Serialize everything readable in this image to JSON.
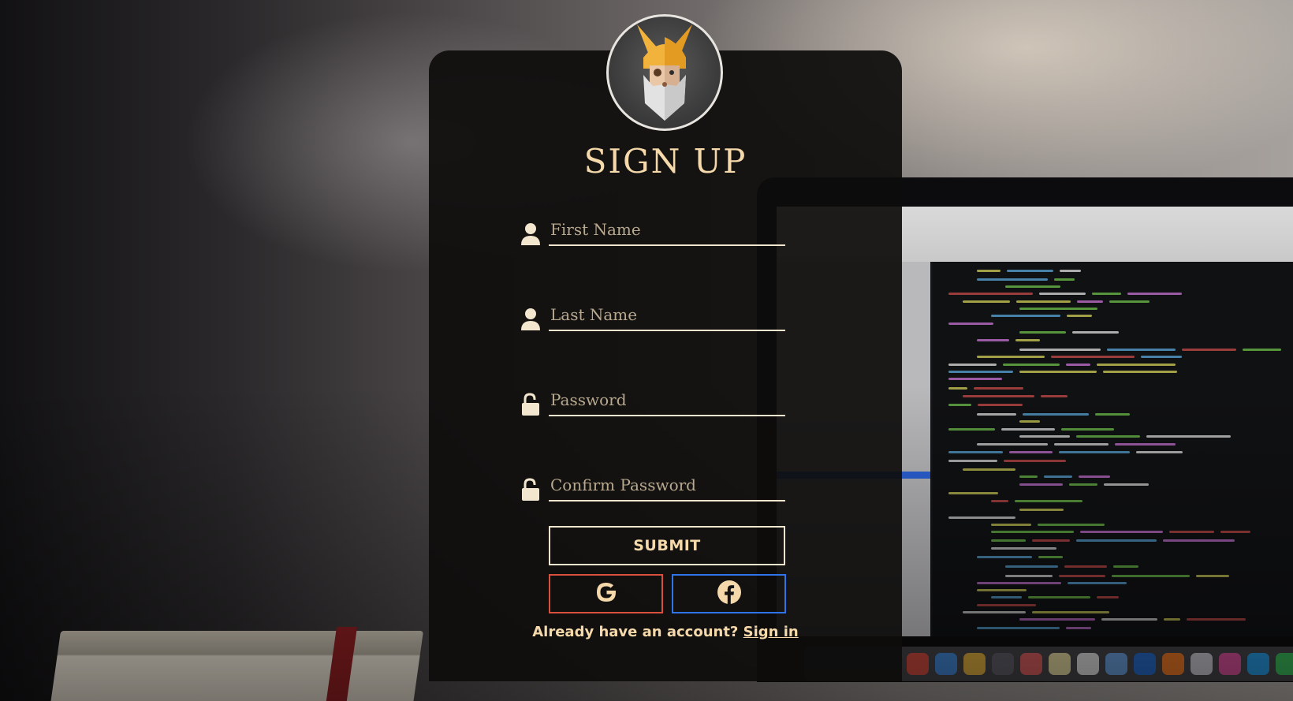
{
  "form": {
    "title": "SIGN UP",
    "fields": [
      {
        "name": "first-name",
        "placeholder": "First Name",
        "value": "",
        "icon": "user-icon"
      },
      {
        "name": "last-name",
        "placeholder": "Last Name",
        "value": "",
        "icon": "user-icon"
      },
      {
        "name": "password",
        "placeholder": "Password",
        "value": "",
        "icon": "unlock-icon"
      },
      {
        "name": "confirm-password",
        "placeholder": "Confirm Password",
        "value": "",
        "icon": "unlock-icon"
      }
    ],
    "submit_label": "SUBMIT",
    "social": {
      "google_icon": "google-icon",
      "facebook_icon": "facebook-icon"
    },
    "footer": {
      "prompt": "Already have an account?",
      "link_label": "Sign in"
    }
  },
  "avatar": {
    "icon": "viking-avatar-icon"
  },
  "colors": {
    "accent_text": "#f5d9aa",
    "card_bg": "#0e0d0c",
    "google_border": "#d9503f",
    "facebook_border": "#2f74e8"
  }
}
